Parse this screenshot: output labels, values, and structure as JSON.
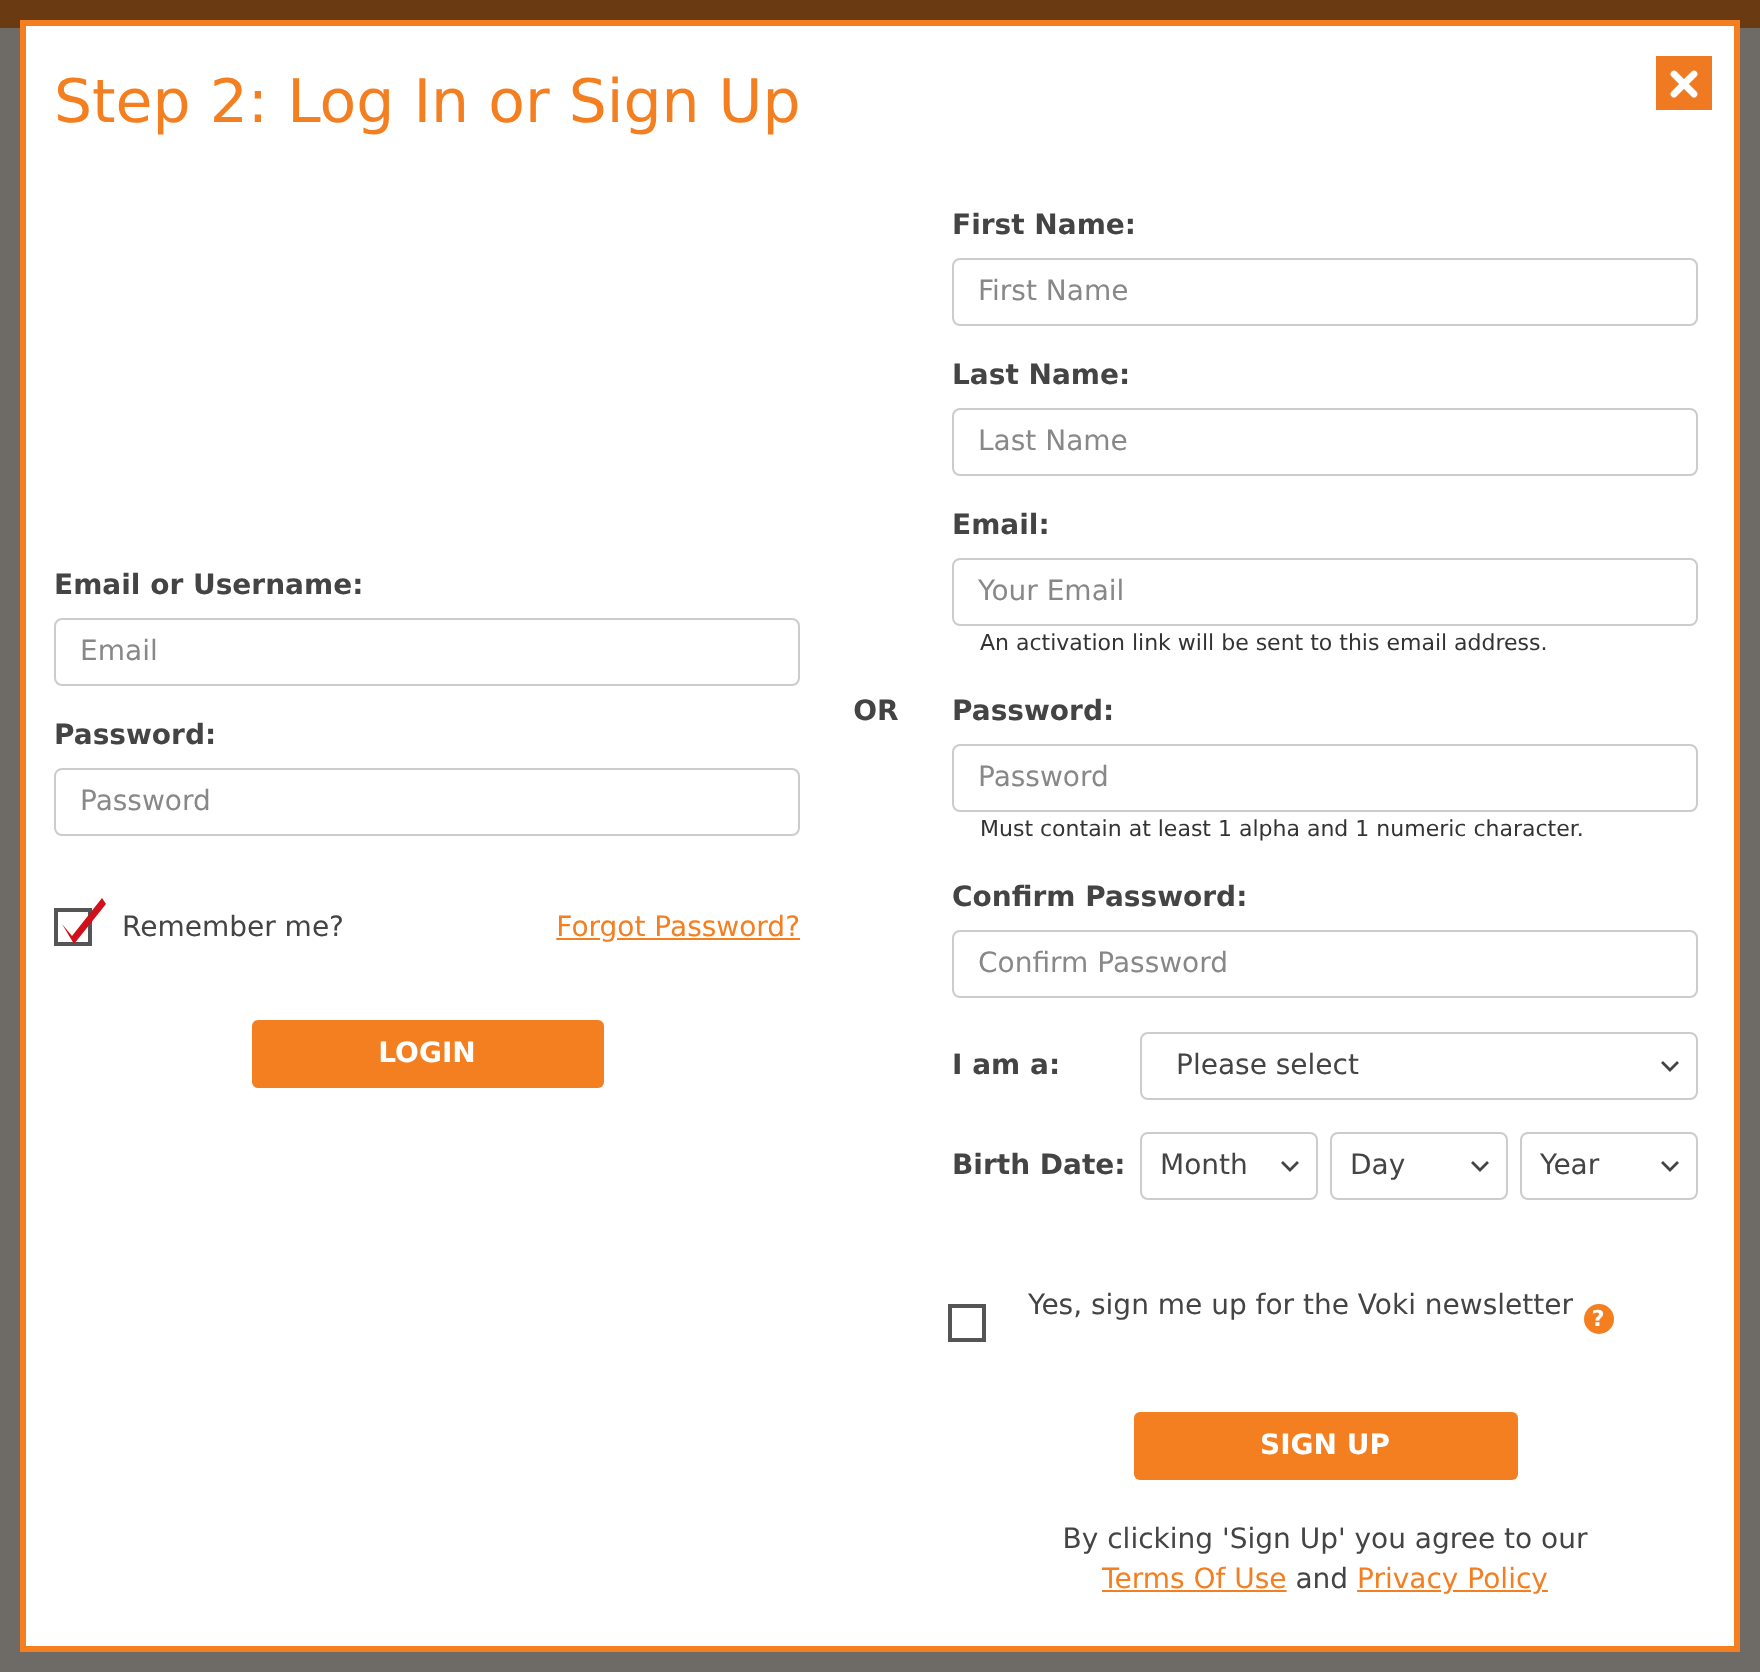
{
  "dialog": {
    "title": "Step 2: Log In or Sign Up"
  },
  "login": {
    "fields": [
      {
        "label": "Email or Username:",
        "placeholder": "Email"
      },
      {
        "label": "Password:",
        "placeholder": "Password"
      }
    ],
    "remember": {
      "label": "Remember me?",
      "checked": true
    },
    "forgot_link": "Forgot Password?",
    "button": "LOGIN"
  },
  "separator": "OR",
  "signup": {
    "fields": [
      {
        "label": "First Name:",
        "placeholder": "First Name"
      },
      {
        "label": "Last Name:",
        "placeholder": "Last Name"
      },
      {
        "label": "Email:",
        "placeholder": "Your Email",
        "hint": "An activation link will be sent to this email address."
      },
      {
        "label": "Password:",
        "placeholder": "Password",
        "hint": "Must contain at least 1 alpha and 1 numeric character."
      },
      {
        "label": "Confirm Password:",
        "placeholder": "Confirm Password"
      }
    ],
    "role": {
      "label": "I am a:",
      "value": "Please select"
    },
    "birth_date": {
      "label": "Birth Date:",
      "selects": [
        "Month",
        "Day",
        "Year"
      ]
    },
    "newsletter": {
      "label": "Yes, sign me up for the Voki newsletter",
      "checked": false,
      "help": "?"
    },
    "button": "SIGN UP",
    "agreement": {
      "text": "By clicking 'Sign Up' you agree to our",
      "terms_link": "Terms Of Use",
      "joiner": "and",
      "privacy_link": "Privacy Policy"
    }
  }
}
